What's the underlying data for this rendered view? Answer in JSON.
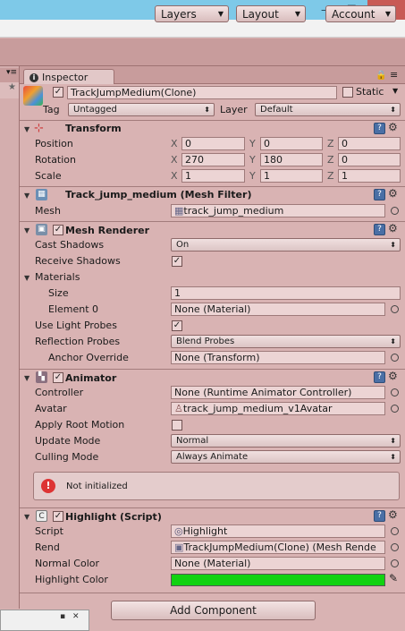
{
  "window": {
    "minimize": "—",
    "restore": "❐",
    "close": "✕"
  },
  "toolbar": {
    "layers": "Layers",
    "layout": "Layout",
    "account": "Account"
  },
  "inspector": {
    "tab_label": "Inspector",
    "object": {
      "name": "TrackJumpMedium(Clone)",
      "static_label": "Static",
      "tag_label": "Tag",
      "tag_value": "Untagged",
      "layer_label": "Layer",
      "layer_value": "Default"
    },
    "transform": {
      "title": "Transform",
      "position_label": "Position",
      "rotation_label": "Rotation",
      "scale_label": "Scale",
      "axes": [
        "X",
        "Y",
        "Z"
      ],
      "position": [
        "0",
        "0",
        "0"
      ],
      "rotation": [
        "270",
        "180",
        "0"
      ],
      "scale": [
        "1",
        "1",
        "1"
      ]
    },
    "mesh_filter": {
      "title": "Track_jump_medium (Mesh Filter)",
      "mesh_label": "Mesh",
      "mesh_value": "track_jump_medium"
    },
    "mesh_renderer": {
      "title": "Mesh Renderer",
      "cast_shadows_label": "Cast Shadows",
      "cast_shadows_value": "On",
      "receive_shadows_label": "Receive Shadows",
      "materials_label": "Materials",
      "size_label": "Size",
      "size_value": "1",
      "element0_label": "Element 0",
      "element0_value": "None (Material)",
      "light_probes_label": "Use Light Probes",
      "reflection_probes_label": "Reflection Probes",
      "reflection_probes_value": "Blend Probes",
      "anchor_override_label": "Anchor Override",
      "anchor_override_value": "None (Transform)"
    },
    "animator": {
      "title": "Animator",
      "controller_label": "Controller",
      "controller_value": "None (Runtime Animator Controller)",
      "avatar_label": "Avatar",
      "avatar_value": "track_jump_medium_v1Avatar",
      "root_motion_label": "Apply Root Motion",
      "update_mode_label": "Update Mode",
      "update_mode_value": "Normal",
      "culling_mode_label": "Culling Mode",
      "culling_mode_value": "Always Animate",
      "help_text": "Not initialized"
    },
    "highlight": {
      "title": "Highlight (Script)",
      "script_label": "Script",
      "script_value": "Highlight",
      "rend_label": "Rend",
      "rend_value": "TrackJumpMedium(Clone) (Mesh Rende",
      "normal_color_label": "Normal Color",
      "normal_color_value": "None (Material)",
      "highlight_color_label": "Highlight Color",
      "highlight_color_hex": "#11d211"
    },
    "add_component": "Add Component"
  },
  "colors": {
    "theme": "#d9b3b3",
    "title_bar": "#7ec9e8",
    "close_button": "#c85a55"
  }
}
